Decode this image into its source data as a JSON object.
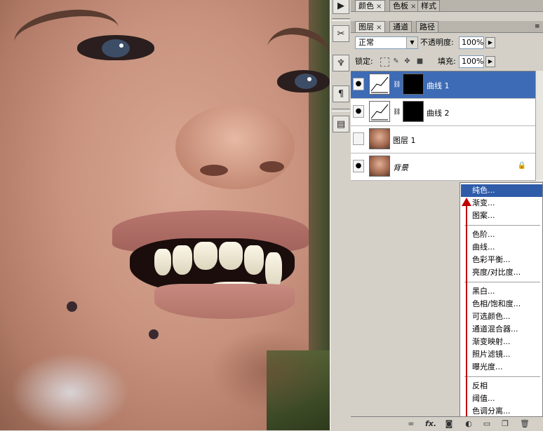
{
  "panel_tabs_top": [
    {
      "label": "颜色",
      "close": "×"
    },
    {
      "label": "色板",
      "close": "×"
    },
    {
      "label": "样式",
      "close": ""
    }
  ],
  "panel_tabs_layers": [
    {
      "label": "图层",
      "close": "×"
    },
    {
      "label": "通道",
      "close": ""
    },
    {
      "label": "路径",
      "close": ""
    }
  ],
  "blend_mode": "正常",
  "opacity_label": "不透明度:",
  "opacity_value": "100%",
  "lock_label": "锁定:",
  "fill_label": "填充:",
  "fill_value": "100%",
  "layers": [
    {
      "name": "曲线 1",
      "selected": true,
      "visible": true
    },
    {
      "name": "曲线 2",
      "selected": false,
      "visible": true
    },
    {
      "name": "图层 1",
      "selected": false,
      "visible": false
    },
    {
      "name": "背景",
      "selected": false,
      "visible": true,
      "locked": true
    }
  ],
  "adjustment_menu": {
    "group1": [
      "纯色...",
      "渐变...",
      "图案..."
    ],
    "group2": [
      "色阶...",
      "曲线...",
      "色彩平衡...",
      "亮度/对比度..."
    ],
    "group3": [
      "黑白...",
      "色相/饱和度...",
      "可选颜色...",
      "通道混合器...",
      "渐变映射...",
      "照片滤镜...",
      "曝光度..."
    ],
    "group4": [
      "反相",
      "阈值...",
      "色调分离..."
    ],
    "highlighted": "纯色..."
  },
  "bottom_icons": [
    "link-layers-icon",
    "fx-icon",
    "add-mask-icon",
    "new-adjustment-layer-icon",
    "new-group-icon",
    "new-layer-icon",
    "trash-icon"
  ],
  "bottom_fx": "fx.",
  "colors": {
    "selection": "#3e6bb5",
    "menu_highlight": "#2f5ca9",
    "annotation_arrow": "#c00000"
  }
}
